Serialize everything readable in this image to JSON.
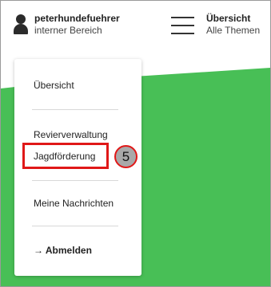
{
  "header": {
    "username": "peterhundefuehrer",
    "area": "interner Bereich",
    "menu_title": "Übersicht",
    "menu_subtitle": "Alle Themen"
  },
  "dropdown": {
    "items": [
      {
        "label": "Übersicht"
      },
      {
        "label": "Revierverwaltung"
      },
      {
        "label": "Jagdförderung"
      },
      {
        "label": "Meine Nachrichten"
      }
    ],
    "logout_label": "Abmelden",
    "logout_arrow": "→"
  },
  "annotation": {
    "step_number": "5",
    "highlight_color": "#e01818"
  },
  "colors": {
    "background_green": "#48bf56",
    "text_dark": "#222222"
  }
}
